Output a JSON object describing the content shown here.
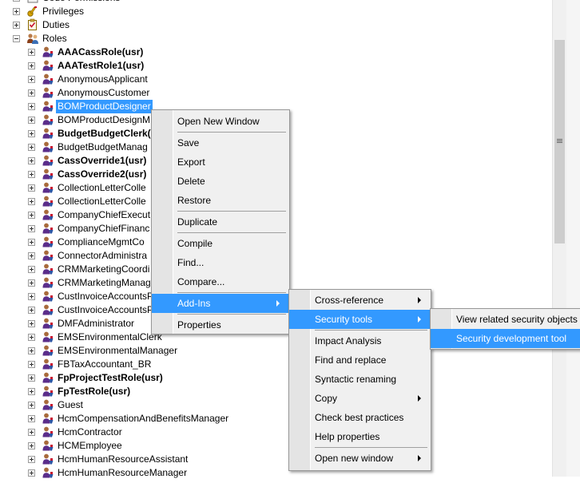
{
  "tree": {
    "top_items": [
      {
        "label": "Code Permissions",
        "expander": "plus",
        "bold": false,
        "selected": false,
        "icon": "code-permissions-icon"
      },
      {
        "label": "Privileges",
        "expander": "plus",
        "bold": false,
        "selected": false,
        "icon": "privileges-icon"
      },
      {
        "label": "Duties",
        "expander": "plus",
        "bold": false,
        "selected": false,
        "icon": "duties-icon"
      },
      {
        "label": "Roles",
        "expander": "minus",
        "bold": false,
        "selected": false,
        "icon": "roles-icon"
      }
    ],
    "roles": [
      {
        "label": "AAACassRole(usr)",
        "bold": true,
        "selected": false
      },
      {
        "label": "AAATestRole1(usr)",
        "bold": true,
        "selected": false
      },
      {
        "label": "AnonymousApplicant",
        "bold": false,
        "selected": false
      },
      {
        "label": "AnonymousCustomer",
        "bold": false,
        "selected": false
      },
      {
        "label": "BOMProductDesigner",
        "bold": false,
        "selected": true
      },
      {
        "label": "BOMProductDesignM",
        "bold": false,
        "selected": false
      },
      {
        "label": "BudgetBudgetClerk(",
        "bold": true,
        "selected": false
      },
      {
        "label": "BudgetBudgetManag",
        "bold": false,
        "selected": false
      },
      {
        "label": "CassOverride1(usr)",
        "bold": true,
        "selected": false
      },
      {
        "label": "CassOverride2(usr)",
        "bold": true,
        "selected": false
      },
      {
        "label": "CollectionLetterColle",
        "bold": false,
        "selected": false
      },
      {
        "label": "CollectionLetterColle",
        "bold": false,
        "selected": false
      },
      {
        "label": "CompanyChiefExecut",
        "bold": false,
        "selected": false
      },
      {
        "label": "CompanyChiefFinanc",
        "bold": false,
        "selected": false
      },
      {
        "label": "ComplianceMgmtCo",
        "bold": false,
        "selected": false
      },
      {
        "label": "ConnectorAdministra",
        "bold": false,
        "selected": false
      },
      {
        "label": "CRMMarketingCoordi",
        "bold": false,
        "selected": false
      },
      {
        "label": "CRMMarketingManag",
        "bold": false,
        "selected": false
      },
      {
        "label": "CustInvoiceAccountsP",
        "bold": false,
        "selected": false
      },
      {
        "label": "CustInvoiceAccountsP",
        "bold": false,
        "selected": false
      },
      {
        "label": "DMFAdministrator",
        "bold": false,
        "selected": false
      },
      {
        "label": "EMSEnvironmentalClerk",
        "bold": false,
        "selected": false
      },
      {
        "label": "EMSEnvironmentalManager",
        "bold": false,
        "selected": false
      },
      {
        "label": "FBTaxAccountant_BR",
        "bold": false,
        "selected": false
      },
      {
        "label": "FpProjectTestRole(usr)",
        "bold": true,
        "selected": false
      },
      {
        "label": "FpTestRole(usr)",
        "bold": true,
        "selected": false
      },
      {
        "label": "Guest",
        "bold": false,
        "selected": false
      },
      {
        "label": "HcmCompensationAndBenefitsManager",
        "bold": false,
        "selected": false
      },
      {
        "label": "HcmContractor",
        "bold": false,
        "selected": false
      },
      {
        "label": "HCMEmployee",
        "bold": false,
        "selected": false
      },
      {
        "label": "HcmHumanResourceAssistant",
        "bold": false,
        "selected": false
      },
      {
        "label": "HcmHumanResourceManager",
        "bold": false,
        "selected": false
      }
    ]
  },
  "context_menu": {
    "items": [
      {
        "label": "Open New Window",
        "submenu": false,
        "highlighted": false
      },
      {
        "sep": true
      },
      {
        "label": "Save",
        "submenu": false,
        "highlighted": false
      },
      {
        "label": "Export",
        "submenu": false,
        "highlighted": false
      },
      {
        "label": "Delete",
        "submenu": false,
        "highlighted": false
      },
      {
        "label": "Restore",
        "submenu": false,
        "highlighted": false
      },
      {
        "sep": true
      },
      {
        "label": "Duplicate",
        "submenu": false,
        "highlighted": false
      },
      {
        "sep": true
      },
      {
        "label": "Compile",
        "submenu": false,
        "highlighted": false
      },
      {
        "label": "Find...",
        "submenu": false,
        "highlighted": false
      },
      {
        "label": "Compare...",
        "submenu": false,
        "highlighted": false
      },
      {
        "sep": true
      },
      {
        "label": "Add-Ins",
        "submenu": true,
        "highlighted": true
      },
      {
        "sep": true
      },
      {
        "label": "Properties",
        "submenu": false,
        "highlighted": false
      }
    ]
  },
  "addins_menu": {
    "items": [
      {
        "label": "Cross-reference",
        "submenu": true,
        "highlighted": false
      },
      {
        "label": "Security tools",
        "submenu": true,
        "highlighted": true
      },
      {
        "sep": true
      },
      {
        "label": "Impact Analysis",
        "submenu": false,
        "highlighted": false
      },
      {
        "label": "Find and replace",
        "submenu": false,
        "highlighted": false
      },
      {
        "label": "Syntactic renaming",
        "submenu": false,
        "highlighted": false
      },
      {
        "label": "Copy",
        "submenu": true,
        "highlighted": false
      },
      {
        "label": "Check best practices",
        "submenu": false,
        "highlighted": false
      },
      {
        "label": "Help properties",
        "submenu": false,
        "highlighted": false
      },
      {
        "sep": true
      },
      {
        "label": "Open new window",
        "submenu": true,
        "highlighted": false
      }
    ]
  },
  "security_menu": {
    "items": [
      {
        "label": "View related security objects",
        "submenu": false,
        "highlighted": false
      },
      {
        "label": "Security development tool",
        "submenu": false,
        "highlighted": true
      }
    ]
  },
  "colors": {
    "selection": "#3399ff",
    "menu_background": "#f0f0f0",
    "menu_gutter": "#e4e4e4"
  }
}
